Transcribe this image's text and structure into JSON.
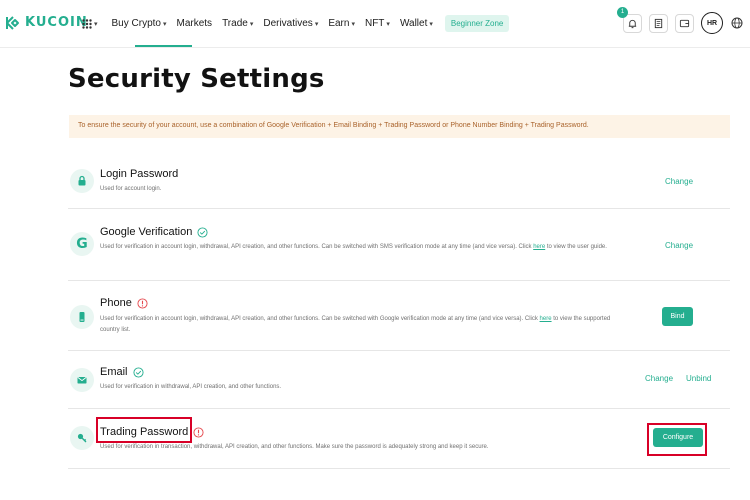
{
  "brand": {
    "name": "KUCOIN",
    "accent": "#24ae8f"
  },
  "nav": {
    "items": [
      {
        "label": "Buy Crypto",
        "dropdown": true
      },
      {
        "label": "Markets",
        "dropdown": false
      },
      {
        "label": "Trade",
        "dropdown": true
      },
      {
        "label": "Derivatives",
        "dropdown": true
      },
      {
        "label": "Earn",
        "dropdown": true
      },
      {
        "label": "NFT",
        "dropdown": true
      },
      {
        "label": "Wallet",
        "dropdown": true
      }
    ],
    "beginner_label": "Beginner Zone",
    "notification_count": "1",
    "avatar_initials": "HR"
  },
  "page": {
    "title": "Security Settings",
    "notice": "To ensure the security of your account, use a combination of Google Verification + Email Binding + Trading Password or Phone Number Binding + Trading Password."
  },
  "settings": [
    {
      "title": "Login Password",
      "status": "none",
      "icon": "lock-icon",
      "desc": "Used for account login.",
      "actions": [
        {
          "label": "Change",
          "type": "link"
        }
      ]
    },
    {
      "title": "Google Verification",
      "status": "verified",
      "icon": "google-icon",
      "desc_pre": "Used for verification in account login, withdrawal, API creation, and other functions. Can be switched with SMS verification mode at any time (and vice versa). Click ",
      "desc_link": "here",
      "desc_post": " to view the user guide.",
      "actions": [
        {
          "label": "Change",
          "type": "link"
        }
      ]
    },
    {
      "title": "Phone",
      "status": "warning",
      "icon": "phone-icon",
      "desc_pre": "Used for verification in account login, withdrawal, API creation, and other functions. Can be switched with Google verification mode at any time (and vice versa). Click ",
      "desc_link": "here",
      "desc_post": " to view the supported country list.",
      "actions": [
        {
          "label": "Bind",
          "type": "button"
        }
      ]
    },
    {
      "title": "Email",
      "status": "verified",
      "icon": "email-icon",
      "desc": "Used for verification in withdrawal, API creation, and other functions.",
      "actions": [
        {
          "label": "Change",
          "type": "link"
        },
        {
          "label": "Unbind",
          "type": "link"
        }
      ]
    },
    {
      "title": "Trading Password",
      "status": "warning",
      "icon": "key-icon",
      "desc": "Used for verification in transaction, withdrawal, API creation, and other functions. Make sure the password is adequately strong and keep it secure.",
      "actions": [
        {
          "label": "Configure",
          "type": "button"
        }
      ]
    }
  ],
  "colors": {
    "accent": "#24ae8f",
    "warning": "#e5484d",
    "highlight": "#d80027",
    "notice_bg": "#fdf3e6"
  }
}
